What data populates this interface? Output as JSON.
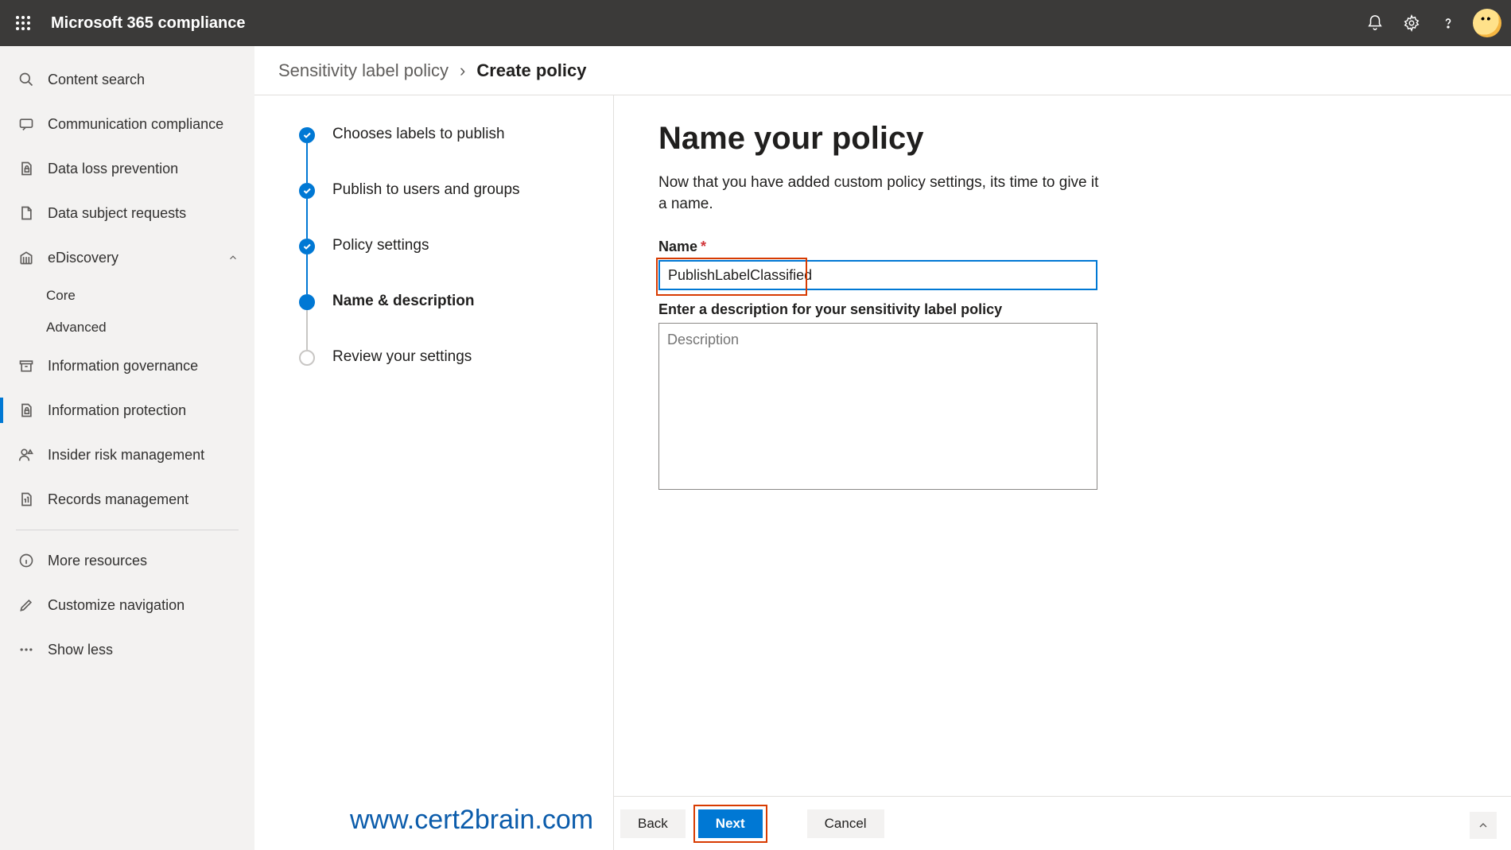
{
  "header": {
    "title": "Microsoft 365 compliance"
  },
  "sidebar": {
    "items": [
      {
        "label": "Content search"
      },
      {
        "label": "Communication compliance"
      },
      {
        "label": "Data loss prevention"
      },
      {
        "label": "Data subject requests"
      },
      {
        "label": "eDiscovery"
      },
      {
        "label": "Core"
      },
      {
        "label": "Advanced"
      },
      {
        "label": "Information governance"
      },
      {
        "label": "Information protection"
      },
      {
        "label": "Insider risk management"
      },
      {
        "label": "Records management"
      },
      {
        "label": "More resources"
      },
      {
        "label": "Customize navigation"
      },
      {
        "label": "Show less"
      }
    ]
  },
  "breadcrumb": {
    "parent": "Sensitivity label policy",
    "current": "Create policy"
  },
  "steps": [
    {
      "label": "Chooses labels to publish"
    },
    {
      "label": "Publish to users and groups"
    },
    {
      "label": "Policy settings"
    },
    {
      "label": "Name & description"
    },
    {
      "label": "Review your settings"
    }
  ],
  "form": {
    "heading": "Name your policy",
    "description": "Now that you have added custom policy settings, its time to give it a name.",
    "name_label": "Name",
    "name_value": "PublishLabelClassified",
    "desc_label": "Enter a description for your sensitivity label policy",
    "desc_placeholder": "Description"
  },
  "footer": {
    "back": "Back",
    "next": "Next",
    "cancel": "Cancel"
  },
  "watermark": "www.cert2brain.com"
}
